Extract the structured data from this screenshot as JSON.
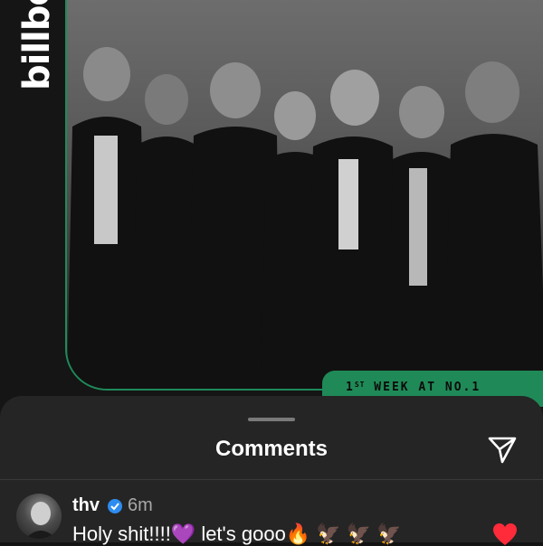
{
  "post": {
    "brand": "billboard",
    "banner": {
      "superscript": "ST",
      "prefix": "1",
      "rest": " WEEK AT NO.1"
    }
  },
  "sheet": {
    "title": "Comments"
  },
  "comment": {
    "username": "thv",
    "time": "6m",
    "text": "Holy shit!!!!💜  let's gooo🔥  🦅 🦅 🦅"
  },
  "colors": {
    "accent": "#1f8a57",
    "verified": "#2d8cf0",
    "like": "#ff2b3a"
  },
  "icons": [
    "share-icon",
    "verified-icon",
    "heart-icon"
  ]
}
